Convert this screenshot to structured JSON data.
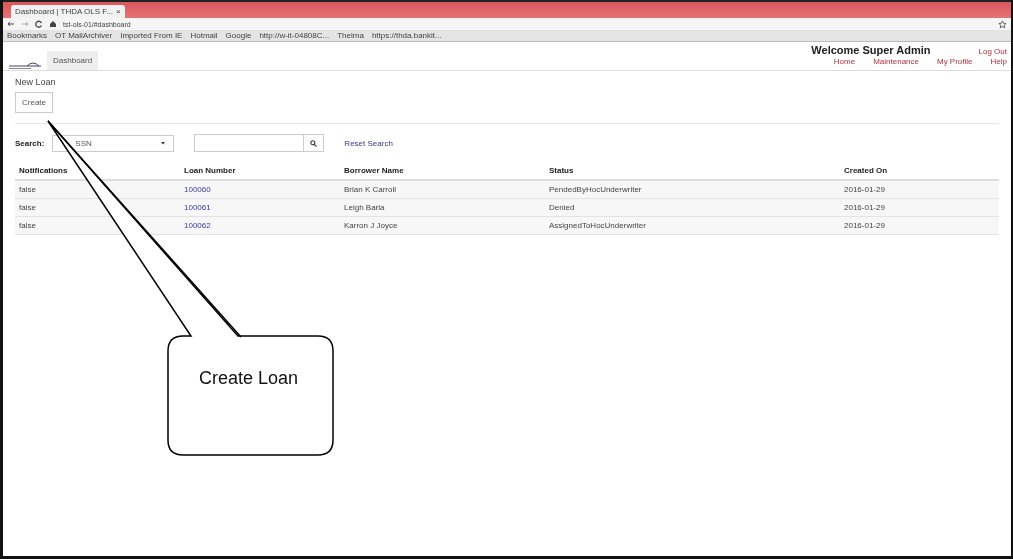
{
  "browser": {
    "tab_title": "Dashboard | THDA OLS F...",
    "tab_close": "×",
    "address": "tst-ols-01/#dashboard",
    "bookmarks": [
      "Bookmarks",
      "OT MailArchiver",
      "Imported From IE",
      "Hotmail",
      "Google",
      "http://w-it-04808C...",
      "Thelma",
      "https://thda.bankit..."
    ]
  },
  "app": {
    "nav_tab": "Dashboard",
    "welcome": "Welcome Super Admin",
    "logout": "Log Out",
    "menu": [
      "Home",
      "Maintenance",
      "My Profile",
      "Help"
    ]
  },
  "section_title": "New Loan",
  "create_button": "Create",
  "search": {
    "label": "Search:",
    "field": "SSN",
    "reset": "Reset Search"
  },
  "table": {
    "columns": [
      "Notifications",
      "Loan Number",
      "Borrower Name",
      "Status",
      "Created On"
    ],
    "rows": [
      {
        "notifications": "false",
        "loan_number": "100060",
        "borrower": "Brian K Carroll",
        "status": "PendedByHocUnderwriter",
        "created_on": "2016-01-29"
      },
      {
        "notifications": "false",
        "loan_number": "100061",
        "borrower": "Leigh Barla",
        "status": "Denied",
        "created_on": "2016-01-29"
      },
      {
        "notifications": "false",
        "loan_number": "100062",
        "borrower": "Karron J Joyce",
        "status": "AssignedToHocUnderwriter",
        "created_on": "2016-01-29"
      }
    ]
  },
  "callout": {
    "text": "Create Loan"
  }
}
